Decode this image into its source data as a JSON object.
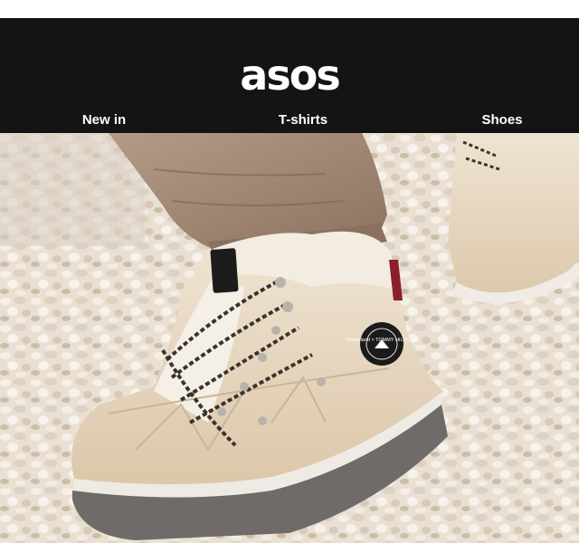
{
  "header": {
    "logo_text": "asos",
    "nav": [
      {
        "label": "New in"
      },
      {
        "label": "T-shirts"
      },
      {
        "label": "Shoes"
      }
    ]
  },
  "hero": {
    "boot_patch_text": "Timberland × TOMMY HILFIGER",
    "colors": {
      "gravel": "#e7ddcf",
      "boot": "#e6d6be",
      "pants": "#9e8471",
      "sole": "#6e6b68"
    }
  }
}
